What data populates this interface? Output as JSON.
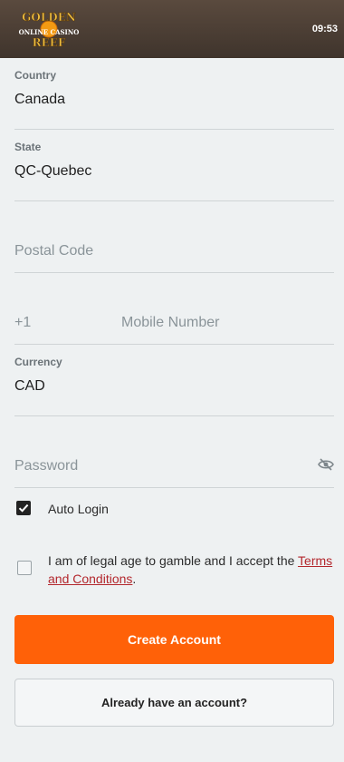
{
  "header": {
    "logo_text_top": "GOLDEN",
    "logo_text_mid": "ONLINE CASINO",
    "logo_text_bottom": "REEF",
    "time": "09:53",
    "logo_icon": "golden-reef-logo"
  },
  "form": {
    "country": {
      "label": "Country",
      "value": "Canada"
    },
    "state": {
      "label": "State",
      "value": "QC-Quebec"
    },
    "postal_code": {
      "placeholder": "Postal Code"
    },
    "mobile": {
      "prefix": "+1",
      "placeholder": "Mobile Number"
    },
    "currency": {
      "label": "Currency",
      "value": "CAD"
    },
    "password": {
      "placeholder": "Password",
      "toggle_icon": "eye-slash-icon"
    }
  },
  "auto_login": {
    "label": "Auto Login",
    "checked": true
  },
  "terms": {
    "text": "I am of legal age to gamble and I accept the ",
    "link": "Terms and Conditions",
    "suffix": ".",
    "checked": false
  },
  "buttons": {
    "create_account": "Create Account",
    "already_have_account": "Already have an account?"
  },
  "colors": {
    "accent": "#ff6108",
    "link": "#b3272d",
    "header_bg": "#4a3d33",
    "page_bg": "#eef1f2"
  }
}
